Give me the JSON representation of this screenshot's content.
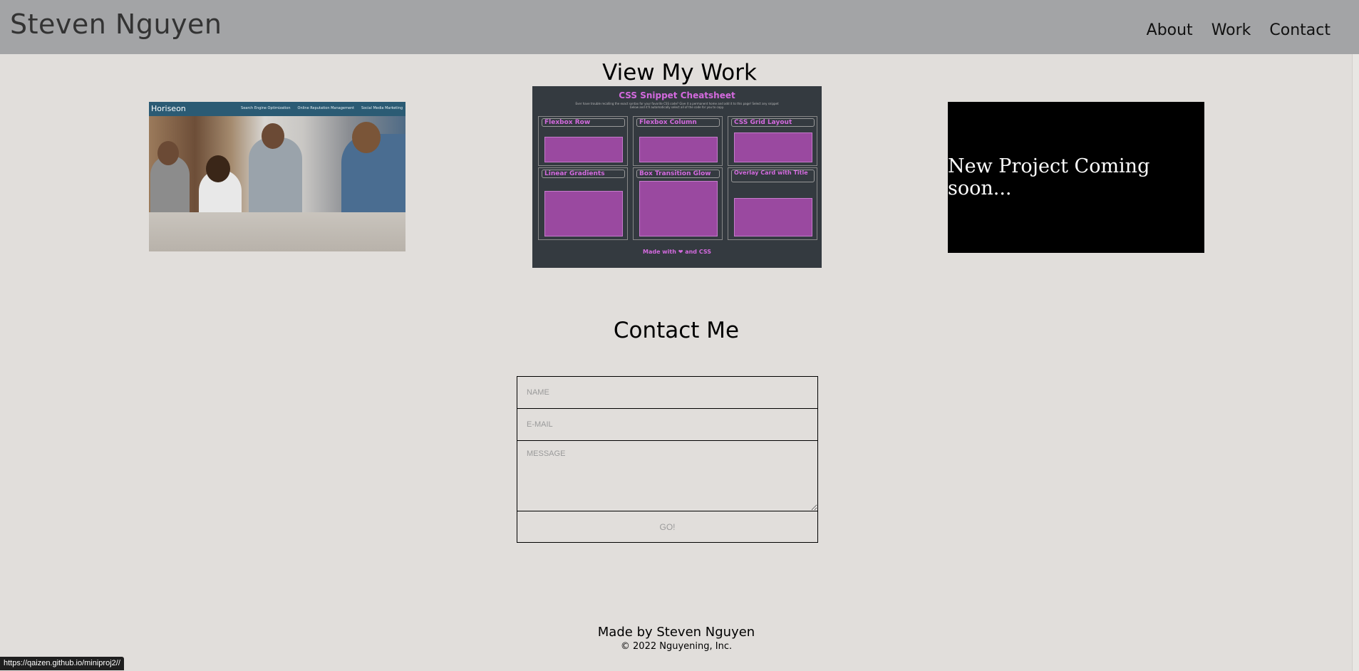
{
  "header": {
    "brand": "Steven Nguyen",
    "nav": [
      "About",
      "Work",
      "Contact"
    ]
  },
  "work": {
    "title": "View My Work",
    "projects": {
      "horiseon": {
        "logo": "Horiseon",
        "links": [
          "Search Engine Optimization",
          "Online Reputation Management",
          "Social Media Marketing"
        ]
      },
      "cheatsheet": {
        "title": "CSS Snippet Cheatsheet",
        "subtitle": "Ever have trouble recalling the exact syntax for your favorite CSS code? Give it a permanent home and add it to this page! Select any snippet below and it'll automatically select all of the code for you to copy.",
        "cells": [
          "Flexbox Row",
          "Flexbox Column",
          "CSS Grid Layout",
          "Linear Gradients",
          "Box Transition Glow",
          "Overlay Card with Title"
        ],
        "footer": "Made with ❤ and CSS"
      },
      "coming_soon": "New Project Coming soon..."
    }
  },
  "contact": {
    "title": "Contact Me",
    "name_placeholder": "NAME",
    "email_placeholder": "E-MAIL",
    "message_placeholder": "MESSAGE",
    "submit": "GO!"
  },
  "footer": {
    "made_by": "Made by Steven Nguyen",
    "copyright": "© 2022 Nguyening, Inc."
  },
  "status_url": "https://qaizen.github.io/miniproj2//",
  "colors": {
    "page_bg": "#e1dedb",
    "header_bg": "#a3a4a6",
    "cheatsheet_bg": "#343a40",
    "cheatsheet_accent": "#d46adf"
  }
}
